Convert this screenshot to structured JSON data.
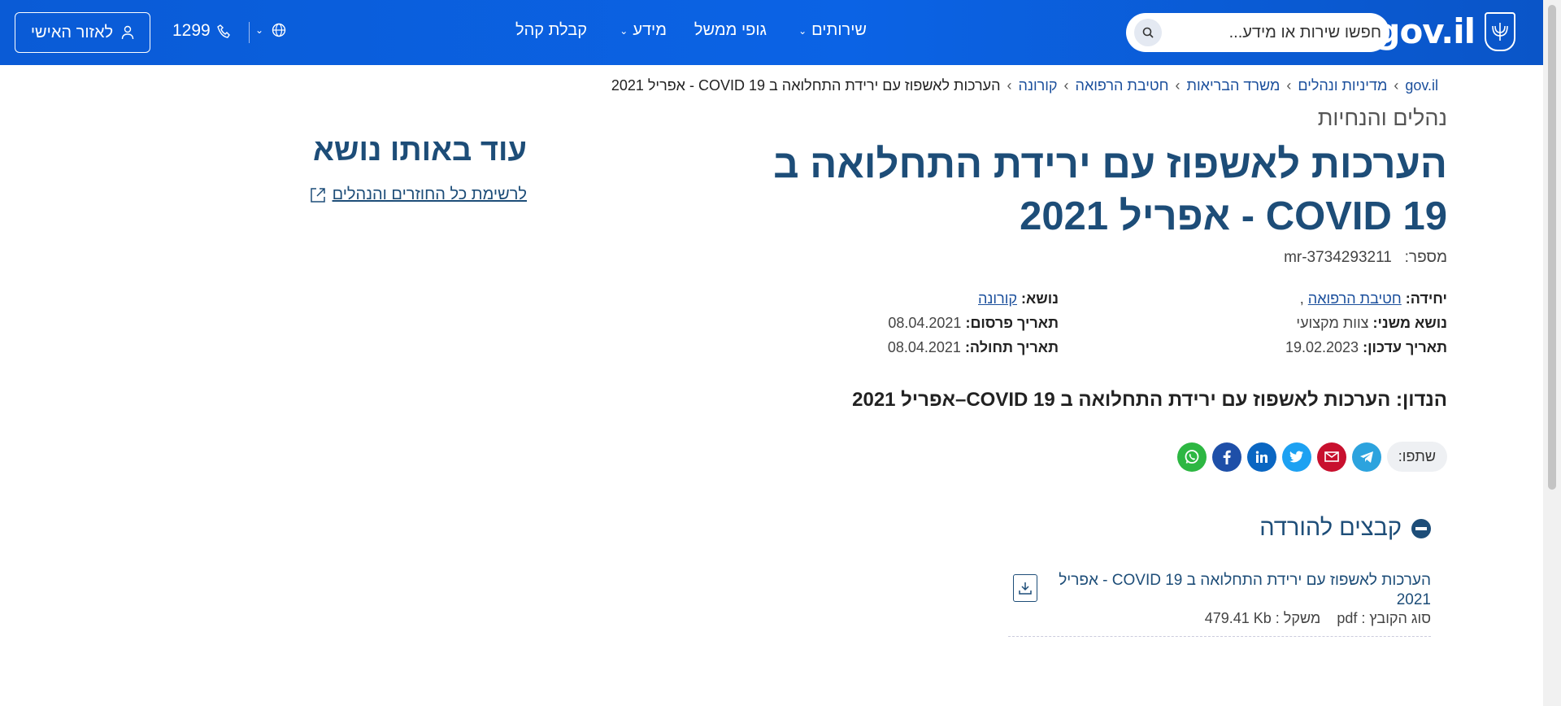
{
  "header": {
    "logo_text": "gov.il",
    "search_placeholder": "חפשו שירות או מידע...",
    "nav": {
      "services": "שירותים",
      "gov_bodies": "גופי ממשל",
      "info": "מידע",
      "reception": "קבלת קהל"
    },
    "phone": "1299",
    "personal_area": "לאזור האישי"
  },
  "breadcrumb": {
    "items": [
      "gov.il",
      "מדיניות ונהלים",
      "משרד הבריאות",
      "חטיבת הרפואה",
      "קורונה"
    ],
    "current": "הערכות לאשפוז עם ירידת התחלואה ב COVID 19 - אפריל 2021",
    "separator": "›"
  },
  "main": {
    "category": "נהלים והנחיות",
    "title": "הערכות לאשפוז עם ירידת התחלואה ב COVID 19 - אפריל 2021",
    "number_label": "מספר:",
    "number_value": "mr-3734293211",
    "unit_label": "יחידה:",
    "unit_value": "חטיבת הרפואה",
    "unit_comma": ",",
    "subtopic_label": "נושא משני:",
    "subtopic_value": "צוות מקצועי",
    "updated_label": "תאריך עדכון:",
    "updated_value": "19.02.2023",
    "topic_label": "נושא:",
    "topic_value": "קורונה",
    "published_label": "תאריך פרסום:",
    "published_value": "08.04.2021",
    "effective_label": "תאריך תחולה:",
    "effective_value": "08.04.2021",
    "subject": "הנדון: הערכות לאשפוז עם ירידת התחלואה ב COVID 19–אפריל 2021"
  },
  "share": {
    "label": "שתפו:",
    "icons": [
      "telegram-icon",
      "email-icon",
      "twitter-icon",
      "linkedin-icon",
      "facebook-icon",
      "whatsapp-icon"
    ]
  },
  "files": {
    "heading": "קבצים להורדה",
    "items": [
      {
        "name": "הערכות לאשפוז עם ירידת התחלואה ב COVID 19 - אפריל 2021",
        "type_label": "סוג הקובץ :",
        "type_value": "pdf",
        "size_label": "משקל :",
        "size_value": "479.41 Kb"
      }
    ]
  },
  "sidebar": {
    "title": "עוד באותו נושא",
    "link": "לרשימת כל החוזרים והנהלים"
  },
  "colors": {
    "header_blue": "#0b63e5",
    "title_blue": "#1d4d78",
    "link_blue": "#1b4f9c"
  }
}
